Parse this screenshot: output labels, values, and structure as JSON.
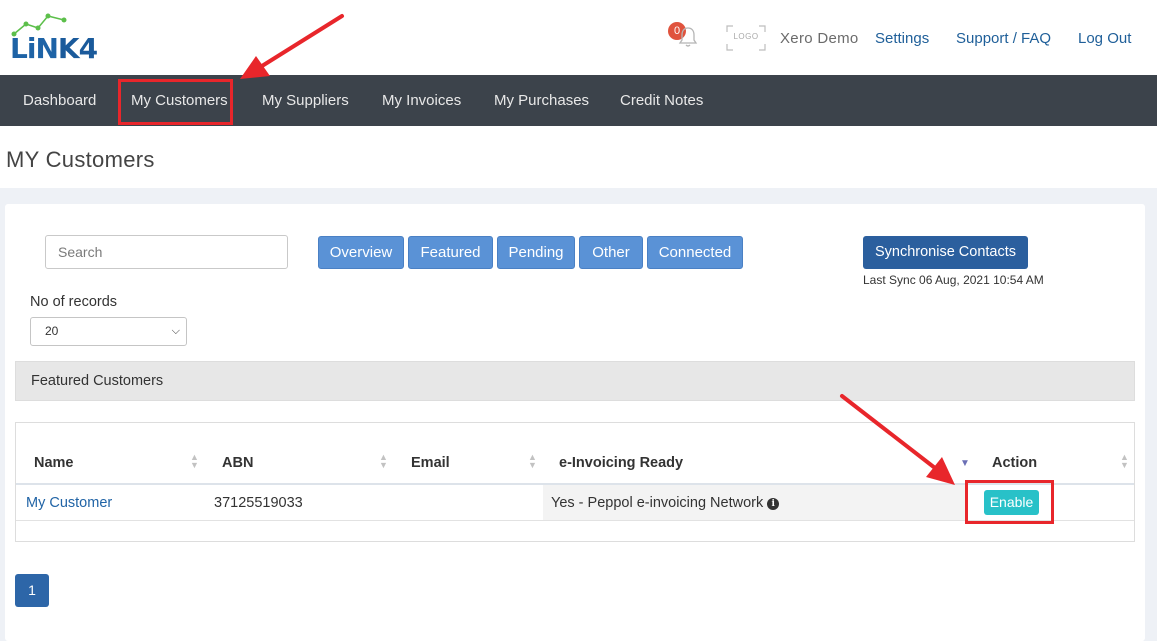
{
  "header": {
    "logo_text_a": "LiN",
    "logo_text_b": "K4",
    "notification_count": "0",
    "logo_placeholder": "LOGO",
    "company_name": "Xero Demo",
    "links": {
      "settings": "Settings",
      "support": "Support / FAQ",
      "logout": "Log Out"
    }
  },
  "nav": {
    "dashboard": "Dashboard",
    "customers": "My Customers",
    "suppliers": "My Suppliers",
    "invoices": "My Invoices",
    "purchases": "My Purchases",
    "credit_notes": "Credit Notes"
  },
  "page": {
    "title": "MY Customers"
  },
  "search": {
    "placeholder": "Search"
  },
  "filters": {
    "overview": "Overview",
    "featured": "Featured",
    "pending": "Pending",
    "other": "Other",
    "connected": "Connected"
  },
  "sync": {
    "button": "Synchronise Contacts",
    "last_sync": "Last Sync 06 Aug, 2021 10:54 AM"
  },
  "records": {
    "label": "No of records",
    "value": "20"
  },
  "section": {
    "title": "Featured Customers"
  },
  "table": {
    "columns": {
      "name": "Name",
      "abn": "ABN",
      "email": "Email",
      "einvoicing": "e-Invoicing Ready",
      "action": "Action"
    },
    "rows": [
      {
        "name": "My Customer",
        "abn": "37125519033",
        "email": "",
        "einvoicing": "Yes - Peppol e-invoicing Network",
        "action": "Enable"
      }
    ]
  },
  "pagination": {
    "current": "1"
  },
  "colors": {
    "nav_bg": "#3c434b",
    "filter_btn": "#5a92d6",
    "sync_btn": "#2b5f9e",
    "enable_btn": "#28c1c8",
    "highlight": "#e8262b"
  }
}
